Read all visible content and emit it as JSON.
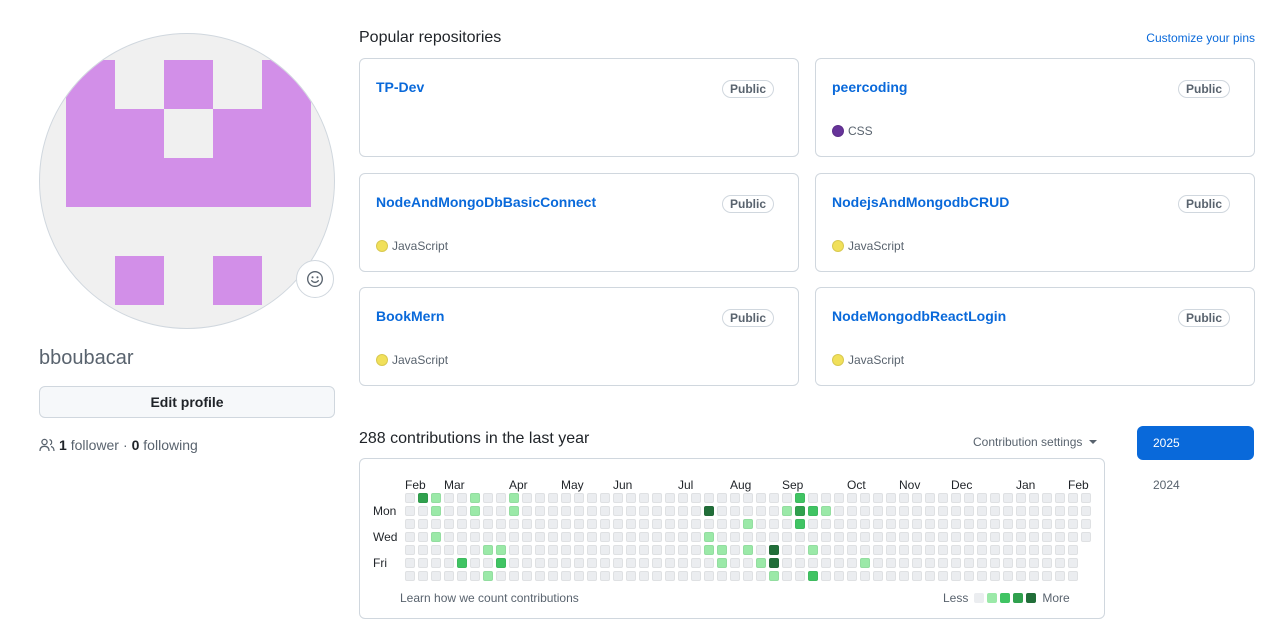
{
  "profile": {
    "username": "bboubacar",
    "edit_profile_label": "Edit profile",
    "followers_count": "1",
    "followers_label": "follower",
    "separator": "·",
    "following_count": "0",
    "following_label": "following",
    "avatar_color": "#d28fe8"
  },
  "pinned": {
    "title": "Popular repositories",
    "customize_label": "Customize your pins",
    "repos": [
      {
        "name": "TP-Dev",
        "visibility": "Public",
        "language": "",
        "language_color": ""
      },
      {
        "name": "peercoding",
        "visibility": "Public",
        "language": "CSS",
        "language_color": "#663399"
      },
      {
        "name": "NodeAndMongoDbBasicConnect",
        "visibility": "Public",
        "language": "JavaScript",
        "language_color": "#f1e05a"
      },
      {
        "name": "NodejsAndMongodbCRUD",
        "visibility": "Public",
        "language": "JavaScript",
        "language_color": "#f1e05a"
      },
      {
        "name": "BookMern",
        "visibility": "Public",
        "language": "JavaScript",
        "language_color": "#f1e05a"
      },
      {
        "name": "NodeMongodbReactLogin",
        "visibility": "Public",
        "language": "JavaScript",
        "language_color": "#f1e05a"
      }
    ]
  },
  "contributions": {
    "title": "288 contributions in the last year",
    "settings_label": "Contribution settings",
    "months": [
      "Feb",
      "Mar",
      "Apr",
      "May",
      "Jun",
      "Jul",
      "Aug",
      "Sep",
      "Oct",
      "Nov",
      "Dec",
      "Jan",
      "Feb"
    ],
    "day_labels": [
      "Mon",
      "Wed",
      "Fri"
    ],
    "learn_label": "Learn how we count contributions",
    "legend_less": "Less",
    "legend_more": "More",
    "level_colors": [
      "#ebedf0",
      "#9be9a8",
      "#40c463",
      "#30a14e",
      "#216e39"
    ],
    "weeks": 53,
    "active_cells": [
      [
        1,
        0,
        3
      ],
      [
        2,
        0,
        1
      ],
      [
        2,
        1,
        1
      ],
      [
        2,
        3,
        1
      ],
      [
        5,
        0,
        1
      ],
      [
        5,
        1,
        1
      ],
      [
        6,
        4,
        1
      ],
      [
        6,
        6,
        1
      ],
      [
        4,
        5,
        2
      ],
      [
        8,
        0,
        1
      ],
      [
        8,
        1,
        1
      ],
      [
        7,
        4,
        1
      ],
      [
        7,
        5,
        2
      ],
      [
        23,
        1,
        4
      ],
      [
        23,
        3,
        1
      ],
      [
        23,
        4,
        1
      ],
      [
        24,
        4,
        1
      ],
      [
        24,
        5,
        1
      ],
      [
        26,
        2,
        1
      ],
      [
        26,
        4,
        1
      ],
      [
        27,
        5,
        1
      ],
      [
        28,
        4,
        4
      ],
      [
        28,
        5,
        4
      ],
      [
        28,
        6,
        1
      ],
      [
        29,
        1,
        1
      ],
      [
        30,
        1,
        3
      ],
      [
        30,
        2,
        2
      ],
      [
        31,
        1,
        2
      ],
      [
        31,
        4,
        1
      ],
      [
        31,
        6,
        2
      ],
      [
        32,
        1,
        1
      ],
      [
        30,
        0,
        2
      ],
      [
        35,
        5,
        1
      ]
    ]
  },
  "years": {
    "items": [
      "2025",
      "2024"
    ],
    "active": "2025"
  }
}
